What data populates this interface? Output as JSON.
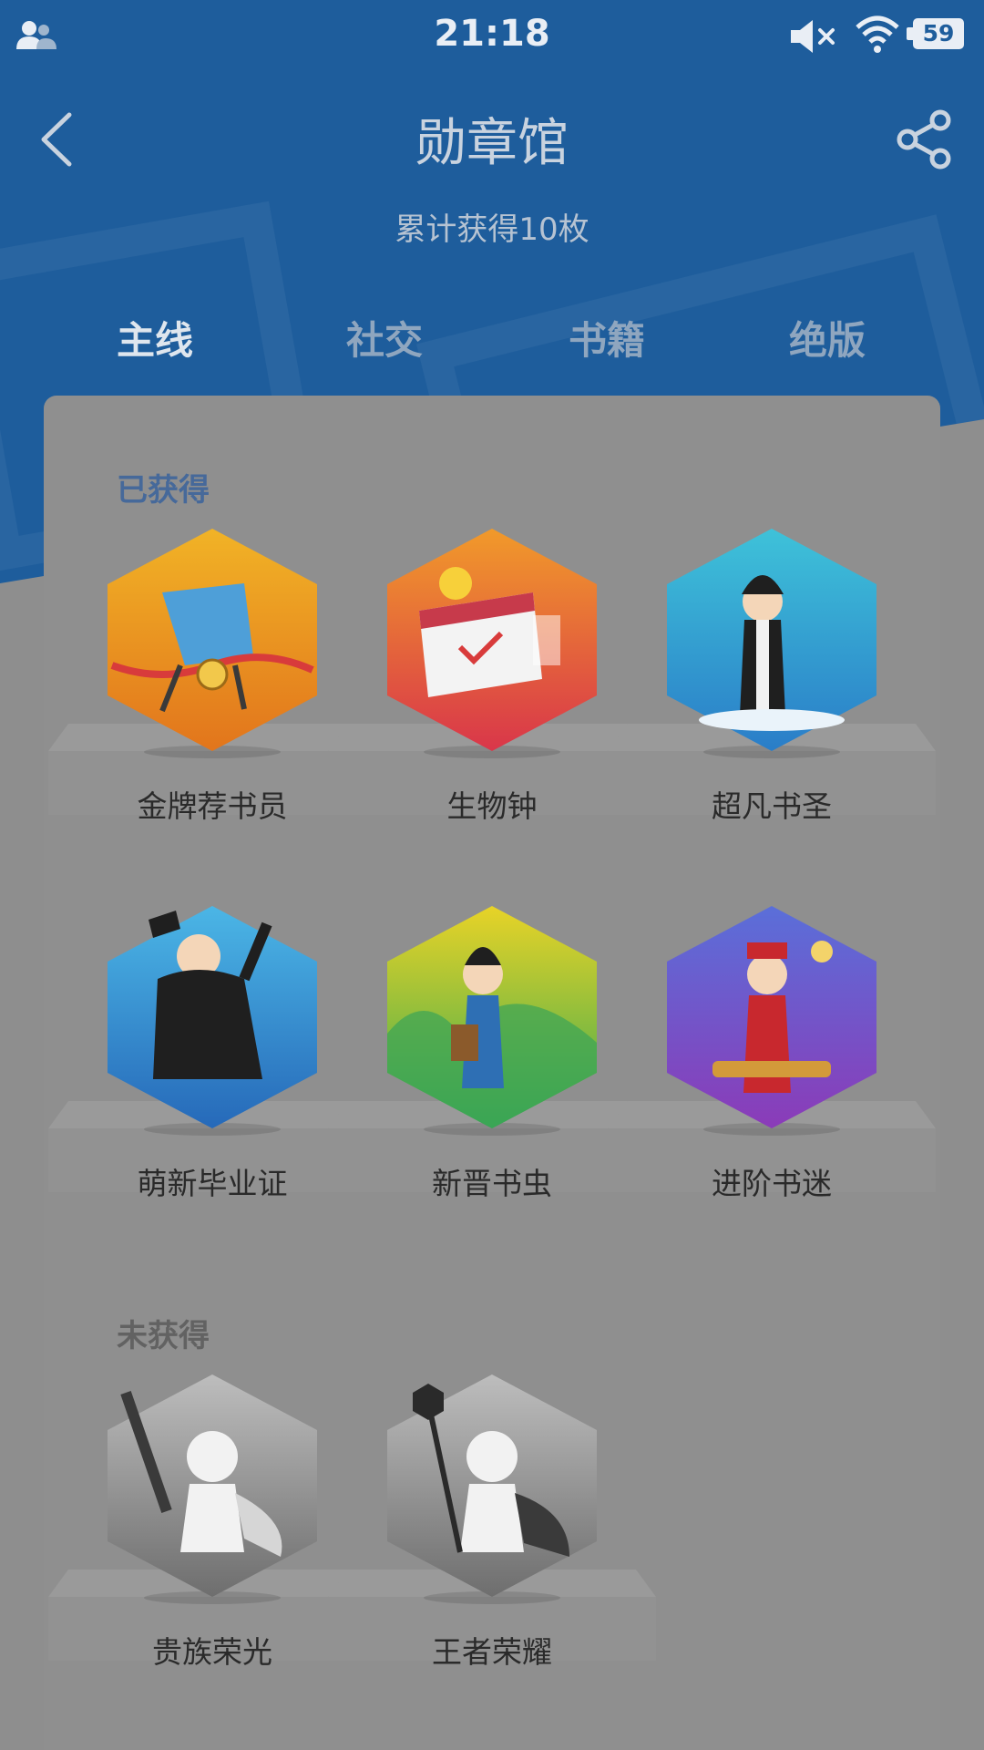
{
  "status_bar": {
    "time": "21:18",
    "battery": "59",
    "icons": [
      "contacts-icon",
      "mute-icon",
      "wifi-icon",
      "battery-icon"
    ]
  },
  "header": {
    "title": "勋章馆",
    "subtitle": "累计获得10枚",
    "back_icon": "chevron-left-icon",
    "share_icon": "share-icon"
  },
  "tabs": [
    {
      "label": "主线",
      "active": true
    },
    {
      "label": "社交",
      "active": false
    },
    {
      "label": "书籍",
      "active": false
    },
    {
      "label": "绝版",
      "active": false
    }
  ],
  "sections": {
    "earned": {
      "label": "已获得",
      "badges": [
        {
          "name": "金牌荐书员",
          "colors": [
            "#f1b326",
            "#e2751c"
          ]
        },
        {
          "name": "生物钟",
          "colors": [
            "#f19a2a",
            "#d9364a"
          ]
        },
        {
          "name": "超凡书圣",
          "colors": [
            "#3ec2d9",
            "#2a7dc8"
          ]
        },
        {
          "name": "萌新毕业证",
          "colors": [
            "#4bb6e6",
            "#2669b9"
          ]
        },
        {
          "name": "新晋书虫",
          "colors": [
            "#e8d327",
            "#39a951"
          ]
        },
        {
          "name": "进阶书迷",
          "colors": [
            "#5a6fd9",
            "#8b3bb8"
          ]
        }
      ]
    },
    "unearned": {
      "label": "未获得",
      "badges": [
        {
          "name": "贵族荣光",
          "colors": [
            "#bdbdbd",
            "#6e6e6e"
          ]
        },
        {
          "name": "王者荣耀",
          "colors": [
            "#bdbdbd",
            "#6e6e6e"
          ]
        }
      ]
    }
  },
  "colors": {
    "header_blue": "#1e5d9c",
    "overlay_gray": "#8e8e8e",
    "earned_label": "#46699a"
  }
}
